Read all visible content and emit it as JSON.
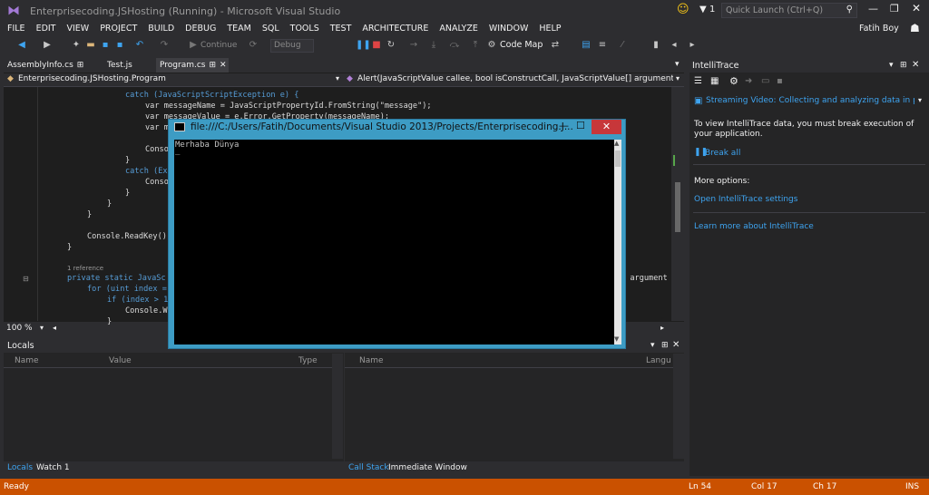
{
  "window_title": "Enterprisecoding.JSHosting (Running) - Microsoft Visual Studio",
  "quick_launch_placeholder": "Quick Launch (Ctrl+Q)",
  "notification_count": "1",
  "menu": [
    "FILE",
    "EDIT",
    "VIEW",
    "PROJECT",
    "BUILD",
    "DEBUG",
    "TEAM",
    "SQL",
    "TOOLS",
    "TEST",
    "ARCHITECTURE",
    "ANALYZE",
    "WINDOW",
    "HELP"
  ],
  "user_name": "Fatih Boy",
  "toolbar": {
    "continue_label": "Continue",
    "debug_config": "Debug",
    "code_map_label": "Code Map"
  },
  "tabs": [
    "AssemblyInfo.cs",
    "Test.js",
    "Program.cs"
  ],
  "nav": {
    "class_combo": "Enterprisecoding.JSHosting.Program",
    "member_combo": "Alert(JavaScriptValue callee, bool isConstructCall, JavaScriptValue[] arguments, ushort ar"
  },
  "code": {
    "l1": "catch (JavaScriptScriptException e) {",
    "l2": "var messageName = JavaScriptPropertyId.FromString(\"message\");",
    "l3": "var messageValue = e.Error.GetProperty(messageName);",
    "l4": "var m",
    "l5": "Conso",
    "l6": "}",
    "l7": "catch (Ex",
    "l8": "Conso",
    "l9": "}",
    "l10": "}",
    "l11": "}",
    "l12": "Console.ReadKey();",
    "l13": "}",
    "ref": "1 reference",
    "l14": "private static JavaSc",
    "l14b": ": argument",
    "l15": "for (uint index =",
    "l16": "if (index > 1",
    "l17": "Console.W",
    "l18": "}"
  },
  "zoom": "100 %",
  "locals": {
    "title": "Locals",
    "col_name": "Name",
    "col_value": "Value",
    "col_type": "Type",
    "tab1": "Locals",
    "tab2": "Watch 1"
  },
  "callstack": {
    "col_name": "Name",
    "col_lang": "Langu",
    "tab1": "Call Stack",
    "tab2": "Immediate Window"
  },
  "intellitrace": {
    "title": "IntelliTrace",
    "video": "Streaming Video: Collecting and analyzing data in produc",
    "info": "To view IntelliTrace data, you must break execution of your application.",
    "break_all": "Break all",
    "more": "More options:",
    "settings": "Open IntelliTrace settings",
    "learn": "Learn more about IntelliTrace"
  },
  "console": {
    "title": "file:///C:/Users/Fatih/Documents/Visual Studio 2013/Projects/Enterprisecoding.J...",
    "output": "Merhaba Dünya",
    "cursor": "_"
  },
  "status": {
    "ready": "Ready",
    "ln": "Ln 54",
    "col": "Col 17",
    "ch": "Ch 17",
    "mode": "INS"
  },
  "colors": {
    "status_bar": "#ca5100",
    "console_frame": "#3d9cc4",
    "close_button": "#c7373a"
  }
}
